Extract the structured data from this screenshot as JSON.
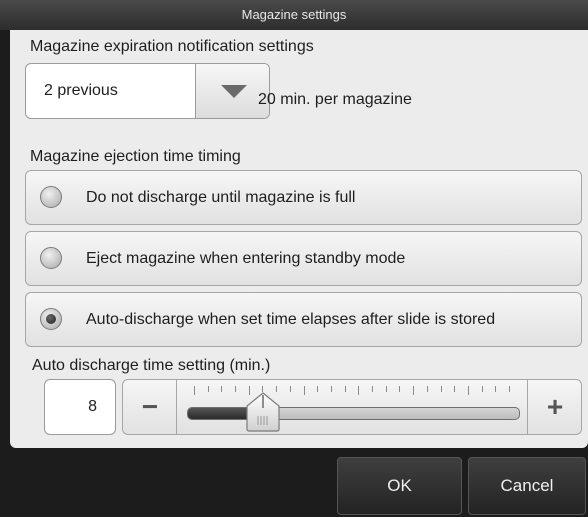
{
  "window": {
    "title": "Magazine settings"
  },
  "expiration": {
    "label": "Magazine expiration notification settings",
    "selected": "2 previous",
    "dropdown_icon": "triangle-down-icon",
    "per_magazine": "20 min. per magazine"
  },
  "ejection": {
    "label": "Magazine ejection time timing",
    "options": [
      {
        "label": "Do not discharge until magazine is full",
        "checked": false
      },
      {
        "label": "Eject magazine when entering standby mode",
        "checked": false
      },
      {
        "label": "Auto-discharge when set time elapses after slide is stored",
        "checked": true
      }
    ]
  },
  "auto_discharge": {
    "label": "Auto discharge time setting (min.)",
    "value": "8",
    "minus_glyph": "−",
    "plus_glyph": "+",
    "slider": {
      "min": 1,
      "max": 60,
      "value": 8
    }
  },
  "buttons": {
    "ok": "OK",
    "cancel": "Cancel"
  },
  "colors": {
    "panel": "#ececec",
    "frame": "#1c1c1c",
    "button": "#2f2f2f"
  }
}
